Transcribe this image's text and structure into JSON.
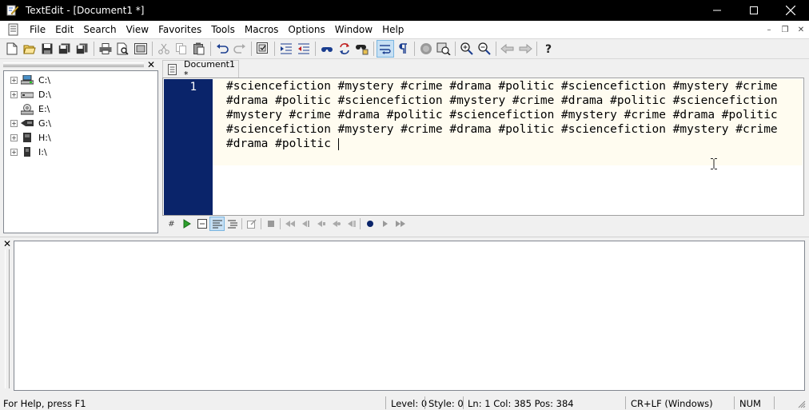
{
  "window": {
    "title": "TextEdit - [Document1 *]",
    "minimize_glyph": "—",
    "maximize_glyph": "☐",
    "close_glyph": "✕"
  },
  "menu": {
    "items": [
      "File",
      "Edit",
      "Search",
      "View",
      "Favorites",
      "Tools",
      "Macros",
      "Options",
      "Window",
      "Help"
    ]
  },
  "mdi": {
    "minimize": "–",
    "restore": "❐",
    "close": "✕"
  },
  "toolbar_icons": [
    "new-icon",
    "open-icon",
    "save-icon",
    "save-all-icon",
    "close-all-icon",
    "print-icon",
    "print-preview-icon",
    "page-setup-icon",
    "cut-icon",
    "copy-icon",
    "paste-icon",
    "undo-icon",
    "redo-icon",
    "find-in-files-icon",
    "indent-icon",
    "outdent-icon",
    "find-icon",
    "replace-icon",
    "find-next-icon",
    "word-wrap-icon",
    "show-paragraph-icon",
    "color-icon",
    "find-in-browser-icon",
    "zoom-in-icon",
    "zoom-out-icon",
    "back-icon",
    "forward-icon",
    "help-icon"
  ],
  "tree": {
    "close_glyph": "✕",
    "drives": [
      {
        "label": "C:\\",
        "icon": "network-drive-icon"
      },
      {
        "label": "D:\\",
        "icon": "hard-drive-icon"
      },
      {
        "label": "E:\\",
        "icon": "cd-drive-icon"
      },
      {
        "label": "G:\\",
        "icon": "removable-drive-icon"
      },
      {
        "label": "H:\\",
        "icon": "disk-drive-icon"
      },
      {
        "label": "I:\\",
        "icon": "disk-drive-icon"
      }
    ],
    "expander": "+"
  },
  "tab": {
    "label": "Document1 *"
  },
  "editor": {
    "line_number": "1",
    "content": "#sciencefiction #mystery #crime #drama #politic #sciencefiction #mystery #crime #drama #politic #sciencefiction #mystery #crime #drama #politic #sciencefiction #mystery #crime #drama #politic #sciencefiction #mystery #crime #drama #politic #sciencefiction #mystery #crime #drama #politic #sciencefiction #mystery #crime #drama #politic "
  },
  "editor_toolbar": {
    "hash_label": "#",
    "icons": [
      "line-numbers-icon",
      "run-icon",
      "block-icon",
      "wrap-icon",
      "outline-icon",
      "edit-icon",
      "stop-icon",
      "rewind-icon",
      "step-back-icon",
      "step-icon",
      "step-into-icon",
      "step-out-icon",
      "record-icon",
      "play-icon",
      "fast-forward-icon"
    ]
  },
  "output": {
    "close_glyph": "✕"
  },
  "status": {
    "help": "For Help, press F1",
    "level": "Level: 0",
    "style": "Style: 0",
    "position": "Ln: 1 Col: 385 Pos: 384",
    "line_ending": "CR+LF (Windows)",
    "num": "NUM"
  }
}
